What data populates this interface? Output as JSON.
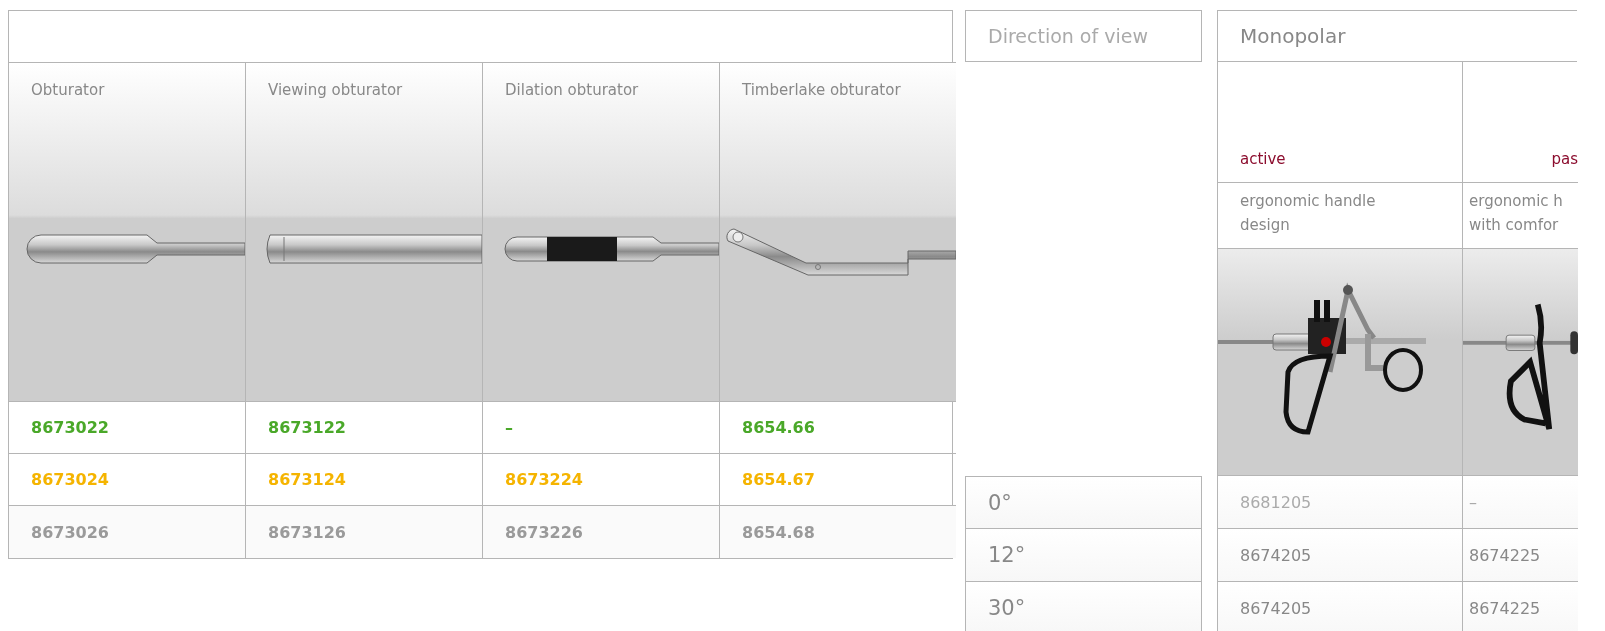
{
  "obturator_table": {
    "columns": [
      {
        "label": "Obturator",
        "kind": "plain"
      },
      {
        "label": "Viewing obturator",
        "kind": "viewing"
      },
      {
        "label": "Dilation obturator",
        "kind": "dilation"
      },
      {
        "label": "Timberlake obturator",
        "kind": "angled"
      }
    ],
    "code_rows": [
      {
        "color": "#4aa829",
        "cells": [
          "8673022",
          "8673122",
          "–",
          "8654.66"
        ]
      },
      {
        "color": "#f5b400",
        "cells": [
          "8673024",
          "8673124",
          "8673224",
          "8654.67"
        ]
      },
      {
        "color": "#9a9a9a",
        "cells": [
          "8673026",
          "8673126",
          "8673226",
          "8654.68"
        ]
      }
    ]
  },
  "direction_of_view": {
    "header": "Direction of view",
    "rows": [
      "0°",
      "12°",
      "30°"
    ]
  },
  "monopolar": {
    "header": "Monopolar",
    "columns": [
      {
        "mode": "active",
        "kind": "active",
        "description_lines": [
          "ergonomic handle",
          "design"
        ]
      },
      {
        "mode": "pas",
        "kind": "passive",
        "description_lines": [
          "ergonomic h",
          "with comfor"
        ]
      }
    ],
    "rows": [
      [
        "8681205",
        "–"
      ],
      [
        "8674205",
        "8674225"
      ],
      [
        "8674205",
        "8674225"
      ]
    ]
  }
}
